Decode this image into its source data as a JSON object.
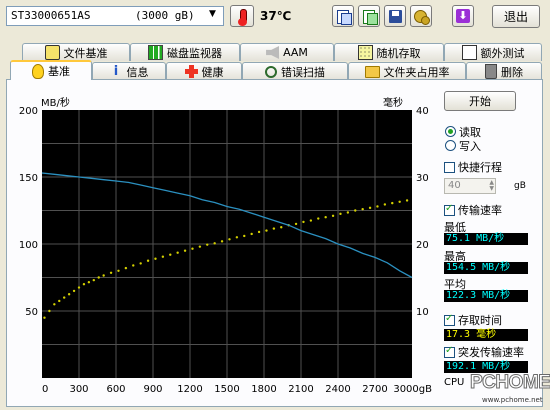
{
  "toolbar": {
    "drive": "ST33000651AS",
    "capacity": "(3000 gB)",
    "temperature": "37℃",
    "exit_label": "退出"
  },
  "tabs_row1": [
    "文件基准",
    "磁盘监视器",
    "AAM",
    "随机存取",
    "额外测试"
  ],
  "tabs_row2": [
    "基准",
    "信息",
    "健康",
    "错误扫描",
    "文件夹占用率",
    "删除"
  ],
  "side": {
    "start_label": "开始",
    "read_label": "读取",
    "write_label": "写入",
    "short_stroke_label": "快捷行程",
    "short_stroke_value": "40",
    "short_stroke_unit": "gB",
    "transfer_rate_label": "传输速率",
    "min_label": "最低",
    "min_value": "75.1 MB/秒",
    "max_label": "最高",
    "max_value": "154.5 MB/秒",
    "avg_label": "平均",
    "avg_value": "122.3 MB/秒",
    "access_time_label": "存取时间",
    "access_time_value": "17.3 毫秒",
    "burst_label": "突发传输速率",
    "burst_value": "192.1 MB/秒",
    "cpu_label": "CPU"
  },
  "watermark": {
    "text": "PCHOME",
    "url": "www.pchome.net"
  },
  "colors": {
    "plot_bg": "#000000",
    "grid": "#505050",
    "transfer_line": "#2b90c0",
    "access_points": "#d4d000",
    "lcd_text": "#00ffff"
  },
  "chart_data": {
    "type": "line",
    "ylabel_left": "MB/秒",
    "ylabel_right": "毫秒",
    "xlabel_unit": "gB",
    "xlim": [
      0,
      3000
    ],
    "ylim_left": [
      0,
      200
    ],
    "ylim_right": [
      0,
      40
    ],
    "x_ticks": [
      "0",
      "300",
      "600",
      "900",
      "1200",
      "1500",
      "1800",
      "2100",
      "2400",
      "2700",
      "3000gB"
    ],
    "y_ticks_left": [
      "200",
      "150",
      "100",
      "50"
    ],
    "y_ticks_right": [
      "40",
      "30",
      "20",
      "10"
    ],
    "grid": true,
    "series": [
      {
        "type": "line",
        "x": [
          0,
          100,
          200,
          300,
          400,
          500,
          600,
          700,
          800,
          900,
          1000,
          1100,
          1200,
          1300,
          1400,
          1500,
          1600,
          1700,
          1800,
          1900,
          2000,
          2100,
          2200,
          2300,
          2400,
          2500,
          2600,
          2700,
          2800,
          2900,
          3000
        ],
        "values": [
          153,
          152,
          151,
          150,
          149,
          148,
          147,
          146,
          144,
          142,
          140,
          138,
          136,
          133,
          131,
          128,
          126,
          123,
          120,
          117,
          114,
          110,
          107,
          104,
          100,
          97,
          93,
          90,
          86,
          80,
          75
        ]
      },
      {
        "type": "scatter",
        "note_axis": "right",
        "x": [
          20,
          60,
          100,
          140,
          180,
          220,
          260,
          300,
          340,
          380,
          420,
          460,
          500,
          560,
          620,
          680,
          740,
          800,
          860,
          920,
          980,
          1040,
          1100,
          1160,
          1220,
          1280,
          1340,
          1400,
          1460,
          1520,
          1580,
          1640,
          1700,
          1760,
          1820,
          1880,
          1940,
          2000,
          2060,
          2120,
          2180,
          2240,
          2300,
          2360,
          2420,
          2480,
          2540,
          2600,
          2660,
          2720,
          2780,
          2840,
          2900,
          2960
        ],
        "values": [
          9,
          10,
          11,
          11.5,
          12,
          12.5,
          13,
          13.5,
          14,
          14.3,
          14.6,
          15,
          15.3,
          15.7,
          16,
          16.4,
          16.8,
          17.1,
          17.5,
          17.8,
          18.1,
          18.4,
          18.7,
          19,
          19.3,
          19.6,
          19.9,
          20.1,
          20.4,
          20.7,
          21,
          21.2,
          21.5,
          21.8,
          22,
          22.3,
          22.5,
          22.8,
          23,
          23.3,
          23.5,
          23.8,
          24,
          24.2,
          24.5,
          24.7,
          25,
          25.2,
          25.4,
          25.6,
          25.9,
          26.1,
          26.3,
          26.5
        ]
      }
    ]
  }
}
